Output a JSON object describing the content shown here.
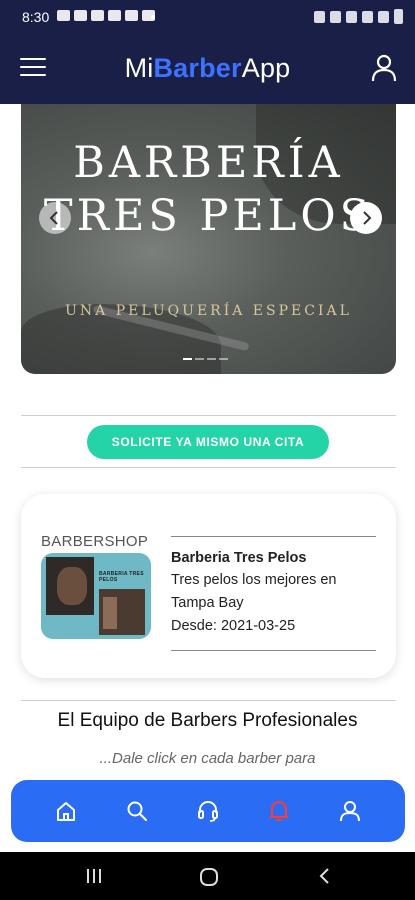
{
  "status_bar": {
    "time": "8:30"
  },
  "header": {
    "brand_prefix": "Mi",
    "brand_accent": "Barber",
    "brand_suffix": "App"
  },
  "carousel": {
    "title_line1": "BARBERÍA",
    "title_line2": "TRES PELOS",
    "subtitle": "UNA PELUQUERÍA ESPECIAL",
    "slide_count": 4,
    "active_slide": 1
  },
  "cta": {
    "label": "SOLICITE YA MISMO UNA CITA"
  },
  "shop": {
    "category": "BARBERSHOP",
    "image_label": "BARBERIA TRES PELOS",
    "name": "Barberia Tres Pelos",
    "description_line1": "Tres pelos los mejores en",
    "description_line2": "Tampa Bay",
    "since": "Desde: 2021-03-25"
  },
  "team": {
    "title": "El Equipo de Barbers Profesionales",
    "subtitle": "...Dale click en cada barber para"
  },
  "bottom_nav": {
    "items": [
      {
        "icon": "home-icon"
      },
      {
        "icon": "search-icon"
      },
      {
        "icon": "headset-icon"
      },
      {
        "icon": "bell-icon"
      },
      {
        "icon": "user-icon"
      }
    ]
  },
  "colors": {
    "header_bg": "#1a1f47",
    "brand_accent": "#3d72ff",
    "cta_bg": "#25d4a6",
    "bottom_nav_bg": "#2a6df4",
    "notification_red": "#ff3b2f"
  }
}
